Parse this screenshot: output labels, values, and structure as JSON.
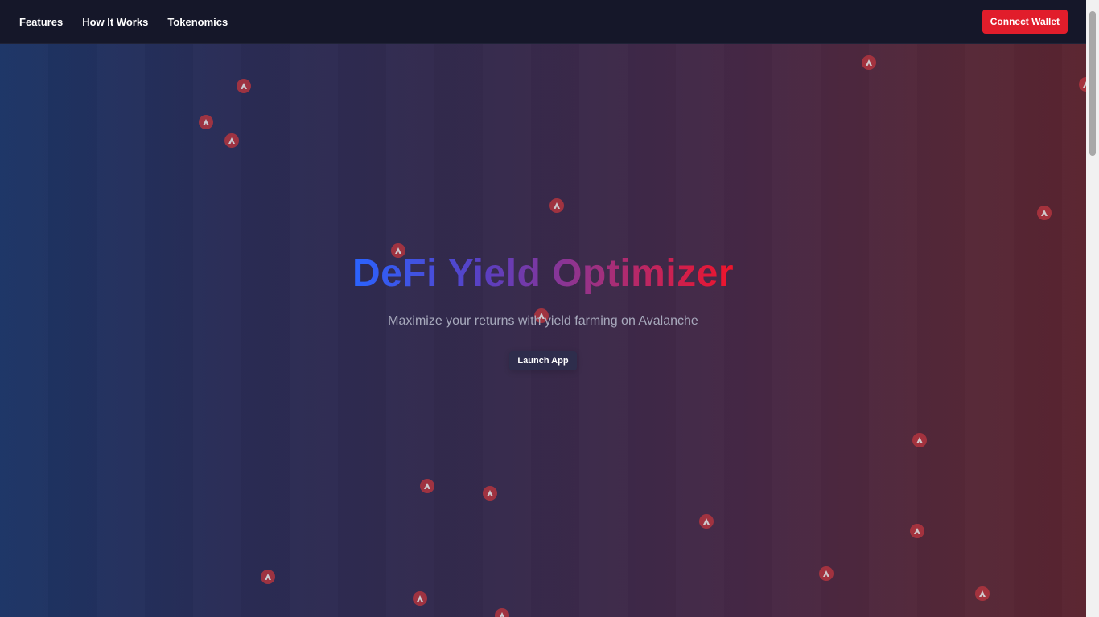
{
  "navbar": {
    "links": [
      "Features",
      "How It Works",
      "Tokenomics"
    ],
    "connect_label": "Connect Wallet"
  },
  "hero": {
    "title": "DeFi Yield Optimizer",
    "subtitle": "Maximize your returns with yield farming on Avalanche",
    "launch_label": "Launch App"
  },
  "colors": {
    "accent": "#e11d2b",
    "title_gradient": [
      "#2a63ff",
      "#5b3fc0",
      "#a0307f",
      "#f0142a"
    ]
  },
  "decorations": {
    "icon": "avalanche-token-icon",
    "count": 21
  }
}
